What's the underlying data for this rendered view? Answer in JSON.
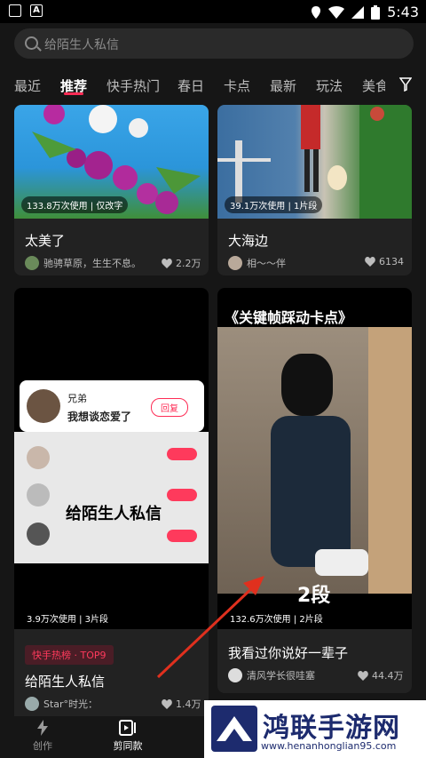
{
  "status": {
    "time": "5:43"
  },
  "search": {
    "placeholder": "给陌生人私信"
  },
  "tabs": [
    "最近",
    "推荐",
    "快手热门",
    "春日",
    "卡点",
    "最新",
    "玩法",
    "美食"
  ],
  "cards": [
    {
      "stats": "133.8万次使用 | 仅改字",
      "title": "太美了",
      "author": "驰骋草原，生生不息。",
      "likes": "2.2万"
    },
    {
      "stats": "39.1万次使用 | 1片段",
      "title": "大海边",
      "author": "相～～伴",
      "likes": "6134"
    },
    {
      "stats": "3.9万次使用 | 3片段",
      "hot_tag": "快手热榜 · TOP9",
      "title": "给陌生人私信",
      "author": "Star°时光：",
      "likes": "1.4万",
      "overlay": {
        "name": "兄弟",
        "message": "我想谈恋爱了",
        "reply": "回复",
        "caption": "给陌生人私信"
      }
    },
    {
      "stats": "132.6万次使用 | 2片段",
      "title": "我看过你说好一辈子",
      "author": "清风学长很哇塞",
      "likes": "44.4万",
      "overlay": {
        "headline": "《关键帧踩动卡点》",
        "badge": "2段"
      }
    }
  ],
  "bottom_nav": [
    {
      "label": "创作"
    },
    {
      "label": "剪同款"
    }
  ],
  "watermark": {
    "title": "鸿联手游网",
    "url": "www.henanhonglian95.com"
  },
  "colors": {
    "accent": "#fe2c55",
    "background": "#161616"
  }
}
